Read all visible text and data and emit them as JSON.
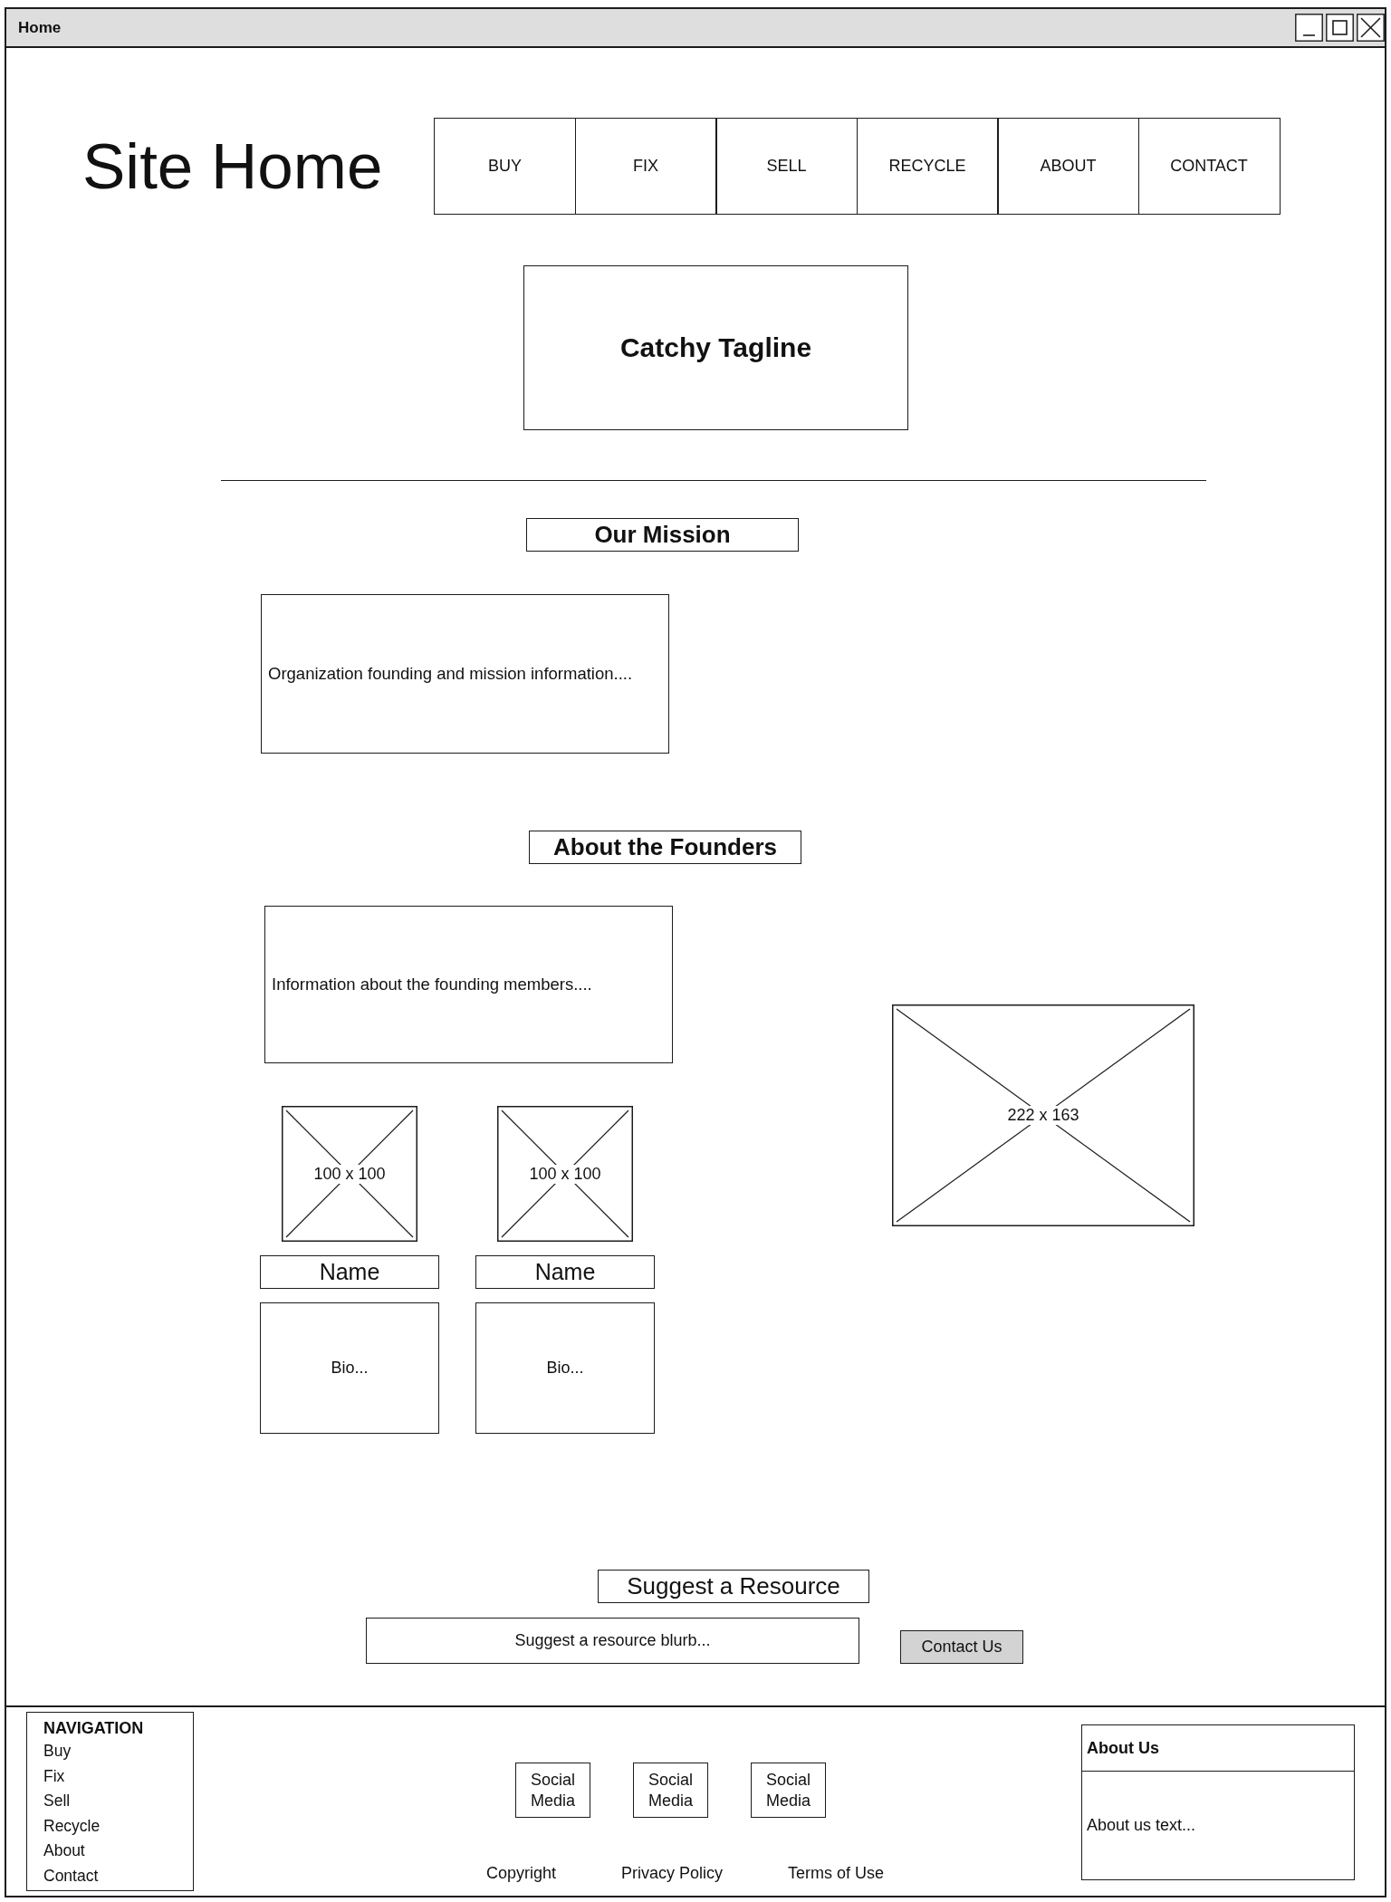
{
  "window": {
    "title": "Home"
  },
  "header": {
    "site_title": "Site Home",
    "nav": [
      {
        "label": "BUY"
      },
      {
        "label": "FIX"
      },
      {
        "label": "SELL"
      },
      {
        "label": "RECYCLE"
      },
      {
        "label": "ABOUT"
      },
      {
        "label": "CONTACT"
      }
    ]
  },
  "tagline": "Catchy Tagline",
  "mission": {
    "heading": "Our Mission",
    "text": "Organization founding and mission information...."
  },
  "founders": {
    "heading": "About the Founders",
    "text": "Information about the founding members....",
    "members": [
      {
        "photo_label": "100 x 100",
        "name": "Name",
        "bio": "Bio..."
      },
      {
        "photo_label": "100 x 100",
        "name": "Name",
        "bio": "Bio..."
      }
    ],
    "image_label": "222 x 163"
  },
  "suggest": {
    "heading": "Suggest a Resource",
    "blurb": "Suggest a resource blurb...",
    "button": "Contact Us"
  },
  "footer": {
    "navigation": {
      "heading": "NAVIGATION",
      "items": [
        "Buy",
        "Fix",
        "Sell",
        "Recycle",
        "About",
        "Contact"
      ]
    },
    "social": [
      "Social Media",
      "Social Media",
      "Social Media"
    ],
    "links": [
      "Copyright",
      "Privacy Policy",
      "Terms of Use"
    ],
    "about": {
      "heading": "About Us",
      "text": "About us text..."
    }
  }
}
